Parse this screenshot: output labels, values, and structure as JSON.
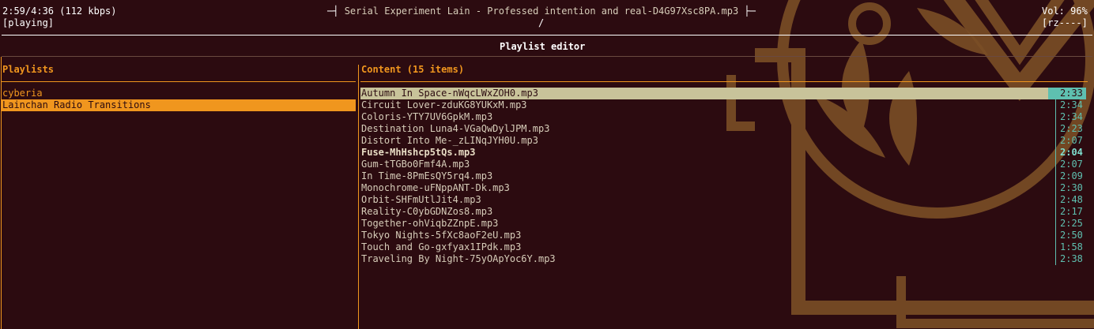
{
  "header": {
    "time": "2:59/4:36 (112 kbps)",
    "state": "[playing]",
    "title_left_deco": "─┤",
    "title": "Serial Experiment Lain - Professed intention and real-D4G97Xsc8PA.mp3",
    "title_right_deco": "├─",
    "path": "/",
    "volume": "Vol: 96%",
    "flags": "[rz----]"
  },
  "screen_title": "Playlist editor",
  "playlists": {
    "heading": "Playlists",
    "items": [
      {
        "label": "cyberia"
      },
      {
        "label": "Lainchan Radio Transitions"
      }
    ]
  },
  "content": {
    "heading": "Content (15 items)",
    "songs": [
      {
        "name": "Autumn In Space-nWqcLWxZOH0.mp3",
        "duration": "2:33"
      },
      {
        "name": "Circuit Lover-zduKG8YUKxM.mp3",
        "duration": "2:34"
      },
      {
        "name": "Coloris-YTY7UV6GpkM.mp3",
        "duration": "2:34"
      },
      {
        "name": "Destination Luna4-VGaQwDylJPM.mp3",
        "duration": "2:23"
      },
      {
        "name": "Distort Into Me-_zLINqJYH0U.mp3",
        "duration": "2:07"
      },
      {
        "name": "Fuse-MhHshcp5tQs.mp3",
        "duration": "2:04"
      },
      {
        "name": "Gum-tTGBo0Fmf4A.mp3",
        "duration": "2:07"
      },
      {
        "name": "In Time-8PmEsQY5rq4.mp3",
        "duration": "2:09"
      },
      {
        "name": "Monochrome-uFNppANT-Dk.mp3",
        "duration": "2:30"
      },
      {
        "name": "Orbit-SHFmUtlJit4.mp3",
        "duration": "2:48"
      },
      {
        "name": "Reality-C0ybGDNZos8.mp3",
        "duration": "2:17"
      },
      {
        "name": "Together-ohViqbZZnpE.mp3",
        "duration": "2:25"
      },
      {
        "name": "Tokyo Nights-5fXc8aoF2eU.mp3",
        "duration": "2:50"
      },
      {
        "name": "Touch and Go-gxfyax1IPdk.mp3",
        "duration": "1:58"
      },
      {
        "name": "Traveling By Night-75yOApYoc6Y.mp3",
        "duration": "2:38"
      }
    ]
  },
  "colors": {
    "background": "#2c0b10",
    "accent": "#f0961e",
    "text": "#d7cdb9",
    "selection": "#c8c39a",
    "duration": "#5ec0b0",
    "wallpaper_motif": "#8a5a2b"
  }
}
